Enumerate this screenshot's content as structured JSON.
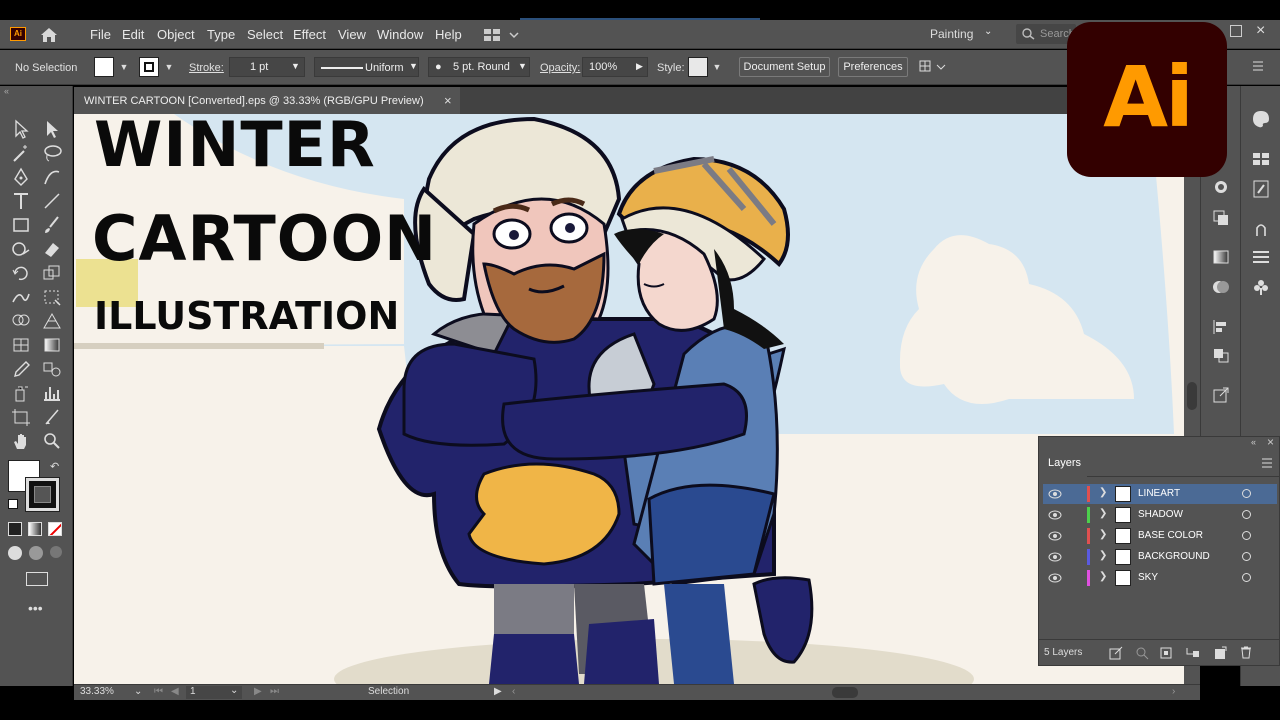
{
  "app": {
    "badge": "Ai",
    "logo_text": "Ai"
  },
  "menu": [
    "File",
    "Edit",
    "Object",
    "Type",
    "Select",
    "Effect",
    "View",
    "Window",
    "Help"
  ],
  "workspace": "Painting",
  "search_placeholder": "Search",
  "control": {
    "selection": "No Selection",
    "stroke_label": "Stroke:",
    "stroke_weight": "1 pt",
    "stroke_profile": "Uniform",
    "brush": "5 pt. Round",
    "opacity_label": "Opacity:",
    "opacity": "100%",
    "style_label": "Style:",
    "document_setup": "Document Setup",
    "preferences": "Preferences"
  },
  "document": {
    "tab_title": "WINTER CARTOON [Converted].eps @ 33.33% (RGB/GPU Preview)",
    "close": "×"
  },
  "artwork": {
    "line1": "WINTER",
    "line2": "CARTOON",
    "line3": "ILLUSTRATION"
  },
  "layers_panel": {
    "title": "Layers",
    "count": "5 Layers",
    "rows": [
      {
        "name": "LINEART",
        "color": "#e05050",
        "selected": true
      },
      {
        "name": "SHADOW",
        "color": "#4cd04c",
        "selected": false
      },
      {
        "name": "BASE COLOR",
        "color": "#e05050",
        "selected": false
      },
      {
        "name": "BACKGROUND",
        "color": "#5a5ae0",
        "selected": false
      },
      {
        "name": "SKY",
        "color": "#e050e0",
        "selected": false
      }
    ]
  },
  "status": {
    "zoom": "33.33%",
    "artboard": "1",
    "tool": "Selection"
  },
  "colors": {
    "panel": "#535353",
    "accent": "#ff9a00",
    "logo_bg": "#330000",
    "selected_row": "#4b6a95"
  }
}
